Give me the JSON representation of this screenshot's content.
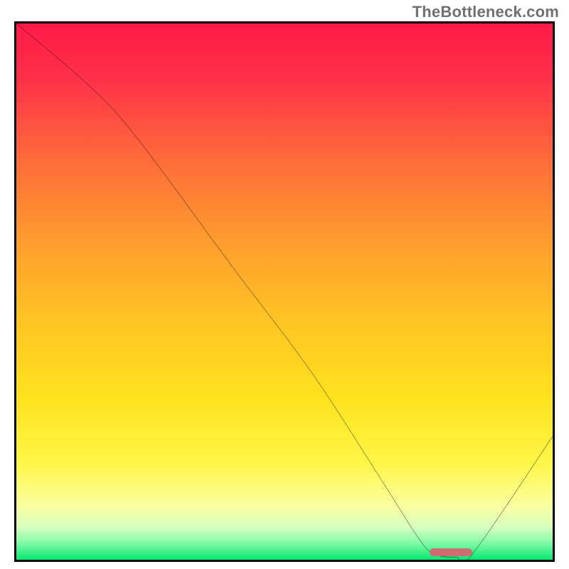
{
  "watermark": "TheBottleneck.com",
  "chart_data": {
    "type": "line",
    "title": "",
    "xlabel": "",
    "ylabel": "",
    "xlim": [
      0,
      100
    ],
    "ylim": [
      0,
      100
    ],
    "grid": false,
    "series": [
      {
        "name": "bottleneck-curve",
        "x": [
          0.0,
          14.0,
          23.0,
          40.0,
          55.0,
          68.0,
          75.0,
          78.0,
          82.0,
          85.0,
          100.0
        ],
        "y": [
          100.0,
          88.0,
          78.0,
          55.0,
          35.0,
          15.0,
          4.0,
          1.0,
          0.5,
          1.0,
          23.0
        ]
      }
    ],
    "optimal_marker": {
      "x_start": 77.0,
      "x_end": 85.0,
      "y": 0.6,
      "color": "#cf6d73"
    },
    "background_gradient": {
      "stops": [
        {
          "offset": 0.0,
          "color": "#ff1a46"
        },
        {
          "offset": 0.1,
          "color": "#ff2f4a"
        },
        {
          "offset": 0.25,
          "color": "#ff6a3a"
        },
        {
          "offset": 0.4,
          "color": "#ff9a2e"
        },
        {
          "offset": 0.55,
          "color": "#ffc323"
        },
        {
          "offset": 0.7,
          "color": "#ffe21e"
        },
        {
          "offset": 0.82,
          "color": "#fff648"
        },
        {
          "offset": 0.9,
          "color": "#f8ff9f"
        },
        {
          "offset": 0.94,
          "color": "#d7ffc0"
        },
        {
          "offset": 0.97,
          "color": "#7cf9a5"
        },
        {
          "offset": 1.0,
          "color": "#06e870"
        }
      ]
    }
  }
}
